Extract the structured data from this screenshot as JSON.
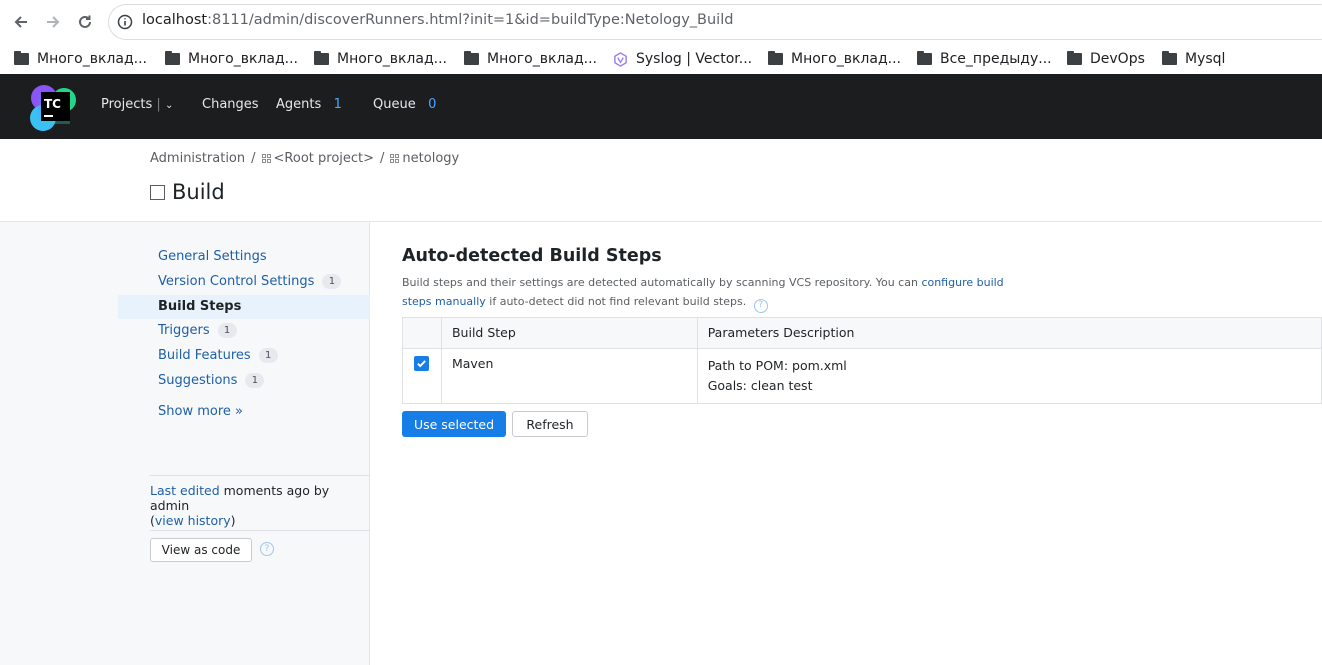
{
  "browser": {
    "url_host": "localhost",
    "url_rest": ":8111/admin/discoverRunners.html?init=1&id=buildType:Netology_Build",
    "bookmarks": [
      {
        "label": "Много_вклад...",
        "icon": "folder-icon"
      },
      {
        "label": "Много_вклад...",
        "icon": "folder-icon"
      },
      {
        "label": "Много_вклад...",
        "icon": "folder-icon"
      },
      {
        "label": "Много_вклад...",
        "icon": "folder-icon"
      },
      {
        "label": "Syslog | Vector...",
        "icon": "vector-site-icon"
      },
      {
        "label": "Много_вклад...",
        "icon": "folder-icon"
      },
      {
        "label": "Все_предыду...",
        "icon": "folder-icon"
      },
      {
        "label": "DevOps",
        "icon": "folder-icon"
      },
      {
        "label": "Mysql",
        "icon": "folder-icon"
      }
    ]
  },
  "header": {
    "logo_text": "TC",
    "projects_label": "Projects",
    "changes_label": "Changes",
    "agents_label": "Agents",
    "agents_count": "1",
    "queue_label": "Queue",
    "queue_count": "0"
  },
  "breadcrumb": {
    "administration": "Administration",
    "root_project": "<Root project>",
    "project": "netology",
    "separator": "/"
  },
  "page": {
    "title": "Build"
  },
  "sidebar": {
    "items": [
      {
        "label": "General Settings",
        "badge": ""
      },
      {
        "label": "Version Control Settings",
        "badge": "1"
      },
      {
        "label": "Build Steps",
        "badge": ""
      },
      {
        "label": "Triggers",
        "badge": "1"
      },
      {
        "label": "Build Features",
        "badge": "1"
      },
      {
        "label": "Suggestions",
        "badge": "1"
      }
    ],
    "show_more": "Show more »",
    "last_edited_link": "Last edited",
    "last_edited_text": " moments ago by admin",
    "view_history_link": "view history",
    "view_as_code": "View as code"
  },
  "main": {
    "section_title": "Auto-detected Build Steps",
    "desc_before": "Build steps and their settings are detected automatically by scanning VCS repository. You can ",
    "desc_link": "configure build steps manually",
    "desc_after": " if auto-detect did not find relevant build steps.",
    "table": {
      "headers": [
        "",
        "Build Step",
        "Parameters Description"
      ],
      "rows": [
        {
          "checked": true,
          "step": "Maven",
          "params": [
            "Path to POM: pom.xml",
            "Goals: clean test"
          ]
        }
      ]
    },
    "use_selected": "Use selected",
    "refresh": "Refresh"
  },
  "colors": {
    "accent": "#167ee6",
    "link": "#1f5fa8",
    "header_bg": "#1c1d1f",
    "counter": "#4aa7ff"
  }
}
